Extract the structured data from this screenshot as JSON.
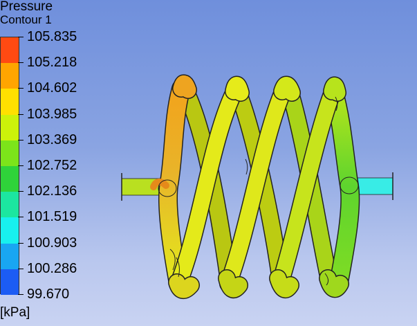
{
  "legend": {
    "title": "Pressure",
    "subtitle": "Contour 1",
    "units": "[kPa]",
    "ticks": [
      "105.835",
      "105.218",
      "104.602",
      "103.985",
      "103.369",
      "102.752",
      "102.136",
      "101.519",
      "100.903",
      "100.286",
      "99.670"
    ],
    "band_colors": [
      "#ff4a12",
      "#ffa500",
      "#ffe000",
      "#ccf20a",
      "#7ce41a",
      "#2fd33a",
      "#1ce6a0",
      "#18f0ee",
      "#19a6f2",
      "#1c5cf4",
      "#1a1aff"
    ]
  },
  "model": {
    "colors": {
      "coil_main": "#e6ec18",
      "coil_shade": "#b3c210",
      "coil_green": "#6ed52a",
      "coil_orange": "#f0a21a",
      "outlet_cyan": "#3ceee6",
      "edge": "#222222"
    }
  }
}
